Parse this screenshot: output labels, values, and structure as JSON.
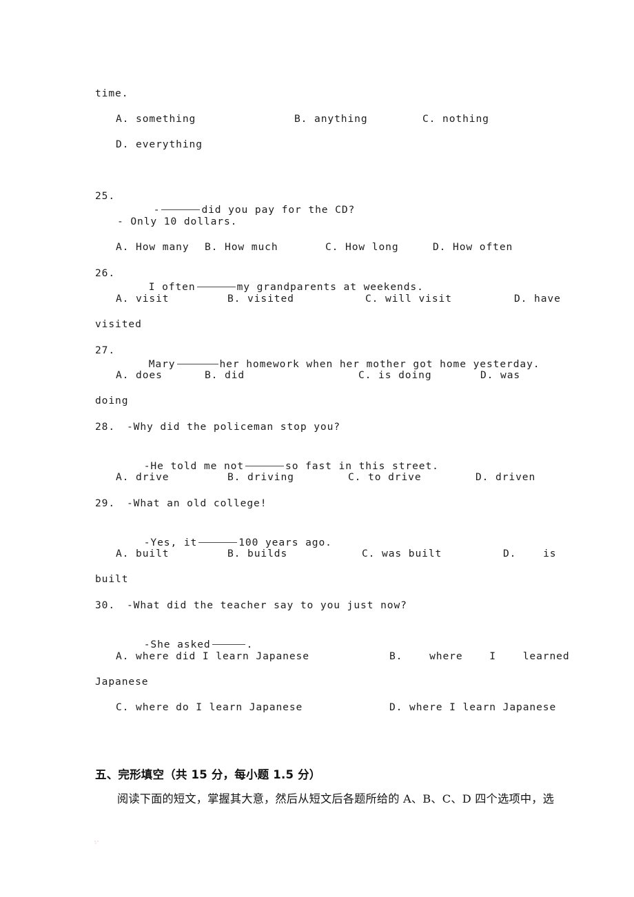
{
  "document": {
    "type": "scanned-exam-paper",
    "language": "en-zh",
    "page_background": "#ffffff",
    "text_color": "#1c1c1c"
  },
  "carryover": {
    "stem_tail": "time.",
    "options_row1": {
      "a": "A. something",
      "b": "B. anything",
      "c": "C. nothing"
    },
    "options_row2": {
      "d": "D. everything"
    }
  },
  "questions": [
    {
      "number": "25.",
      "stem_prefix": "-",
      "stem_suffix": "did you pay for the CD?",
      "reply": "- Only 10 dollars.",
      "options": {
        "a": "A. How many",
        "b": "B. How much",
        "c": "C. How long",
        "d": "D. How often"
      }
    },
    {
      "number": "26.",
      "stem_prefix": "I often",
      "stem_suffix": "my grandparents at weekends.",
      "options": {
        "a": "A. visit",
        "b": "B. visited",
        "c": "C. will visit",
        "d": "D. have",
        "d_wrap": "visited"
      }
    },
    {
      "number": "27.",
      "stem_prefix": "Mary",
      "stem_suffix": "her homework when her mother got home yesterday.",
      "options": {
        "a": "A. does",
        "b": "B. did",
        "c": "C. is doing",
        "d": "D. was",
        "d_wrap": "doing"
      }
    },
    {
      "number": "28.",
      "stem_prefix": "-Why did the policeman stop you?",
      "reply_prefix": "-He told me not",
      "reply_suffix": "so fast in this street.",
      "options": {
        "a": "A. drive",
        "b": "B. driving",
        "c": "C. to drive",
        "d": "D. driven"
      }
    },
    {
      "number": "29.",
      "stem_prefix": "-What an old college!",
      "reply_prefix": "-Yes, it",
      "reply_suffix": "100 years ago.",
      "options": {
        "a": "A. built",
        "b": "B. builds",
        "c": "C. was built",
        "d": "D.    is",
        "d_wrap": "built"
      }
    },
    {
      "number": "30.",
      "stem_prefix": "-What did the teacher say to you just now?",
      "reply_prefix": "-She asked",
      "reply_suffix": ".",
      "options": {
        "a": "A. where did I learn Japanese",
        "b": "B.    where    I    learned",
        "b_wrap": "Japanese",
        "c": "C. where do I learn Japanese",
        "d": "D. where I learn Japanese"
      }
    }
  ],
  "section": {
    "heading": "五、完形填空（共 15 分，每小题 1.5 分）",
    "body": "阅读下面的短文，掌握其大意，然后从短文后各题所给的 A、B、C、D 四个选项中，选"
  }
}
